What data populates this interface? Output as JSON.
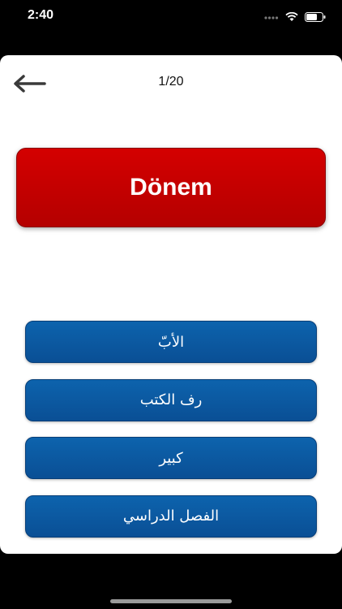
{
  "status_bar": {
    "time": "2:40",
    "icons": [
      "signal-dots-icon",
      "wifi-icon",
      "battery-icon"
    ]
  },
  "header": {
    "back_icon": "arrow-left-icon",
    "progress": "1/20"
  },
  "question": {
    "word": "Dönem",
    "card_color": "#c40000"
  },
  "answers": [
    {
      "label": "الأبّ"
    },
    {
      "label": "رف الكتب"
    },
    {
      "label": "كبير"
    },
    {
      "label": "الفصل الدراسي"
    }
  ],
  "colors": {
    "answer_button": "#0b58a0",
    "background": "#ffffff"
  }
}
